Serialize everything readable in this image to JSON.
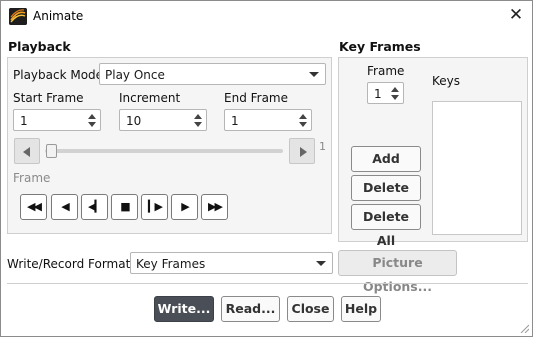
{
  "window": {
    "title": "Animate",
    "icon": "fluent-app-icon",
    "close_icon": "close-icon",
    "close_glyph": "✕"
  },
  "playback": {
    "title": "Playback",
    "mode_label": "Playback Mode",
    "mode_value": "Play Once",
    "start_frame_label": "Start Frame",
    "start_frame_value": "1",
    "increment_label": "Increment",
    "increment_value": "10",
    "end_frame_label": "End Frame",
    "end_frame_value": "1",
    "slider_max_label": "1",
    "slider_position": 0,
    "frame_label": "Frame",
    "controls": [
      {
        "name": "skip-to-start-button",
        "glyph": "◀◀",
        "icon": "rewind-icon"
      },
      {
        "name": "step-back-button",
        "glyph": "◀",
        "icon": "step-back-icon"
      },
      {
        "name": "play-reverse-button",
        "glyph": "◀▎",
        "icon": "play-reverse-icon"
      },
      {
        "name": "stop-button",
        "glyph": "■",
        "icon": "stop-icon"
      },
      {
        "name": "play-button",
        "glyph": "▎▶",
        "icon": "play-icon"
      },
      {
        "name": "step-forward-button",
        "glyph": "▶",
        "icon": "step-forward-icon"
      },
      {
        "name": "skip-to-end-button",
        "glyph": "▶▶",
        "icon": "fast-forward-icon"
      }
    ]
  },
  "key_frames": {
    "title": "Key Frames",
    "frame_label": "Frame",
    "frame_value": "1",
    "keys_label": "Keys",
    "add_label": "Add",
    "delete_label": "Delete",
    "delete_all_label": "Delete All"
  },
  "write_format": {
    "label": "Write/Record Format",
    "value": "Key Frames"
  },
  "picture_options_label": "Picture Options...",
  "footer": {
    "write_label": "Write...",
    "read_label": "Read...",
    "close_label": "Close",
    "help_label": "Help"
  },
  "colors": {
    "primary_button": "#4a4f57",
    "panel_bg": "#f5f5f5",
    "border": "#cfcfcf"
  }
}
